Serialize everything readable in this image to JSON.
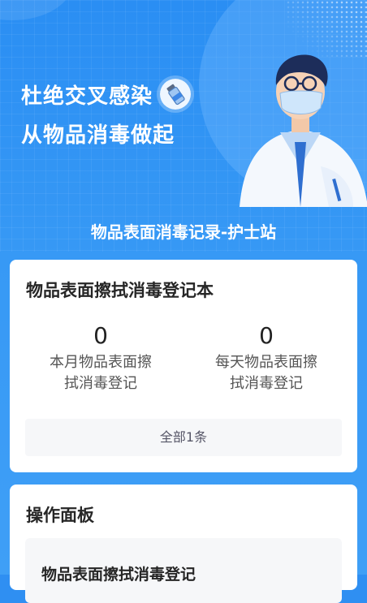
{
  "banner": {
    "slogan_line1": "杜绝交叉感染",
    "slogan_line2": "从物品消毒做起",
    "badge_icon": "medicine-vial-icon",
    "illustration": "nurse-with-mask-illustration"
  },
  "page_title": "物品表面消毒记录-护士站",
  "register_card": {
    "title": "物品表面擦拭消毒登记本",
    "stats": [
      {
        "value": "0",
        "label_line1": "本月物品表面擦",
        "label_line2": "拭消毒登记"
      },
      {
        "value": "0",
        "label_line1": "每天物品表面擦",
        "label_line2": "拭消毒登记"
      }
    ],
    "total_button": "全部1条"
  },
  "operation_panel": {
    "title": "操作面板",
    "items": [
      {
        "label": "物品表面擦拭消毒登记"
      }
    ]
  },
  "colors": {
    "primary_blue": "#2f8ff2",
    "card_bg": "#ffffff",
    "muted_bg": "#f6f7f9"
  }
}
